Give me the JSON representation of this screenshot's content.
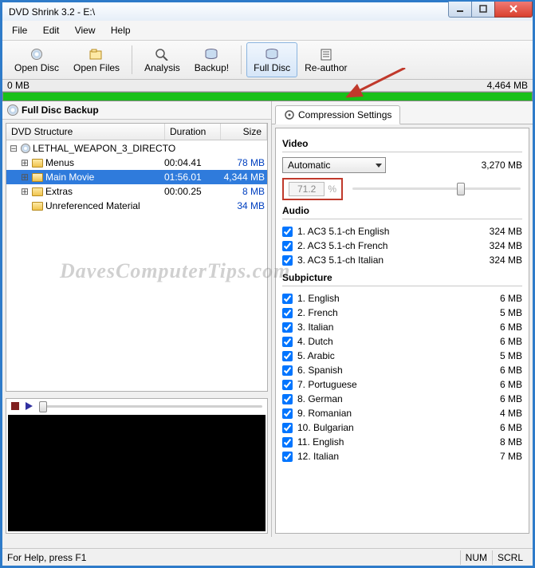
{
  "window": {
    "title": "DVD Shrink 3.2 - E:\\"
  },
  "menu": {
    "file": "File",
    "edit": "Edit",
    "view": "View",
    "help": "Help"
  },
  "toolbar": {
    "open_disc": "Open Disc",
    "open_files": "Open Files",
    "analysis": "Analysis",
    "backup": "Backup!",
    "full_disc": "Full Disc",
    "reauthor": "Re-author"
  },
  "size": {
    "left": "0 MB",
    "right": "4,464 MB"
  },
  "left_panel": {
    "title": "Full Disc Backup"
  },
  "columns": {
    "name": "DVD Structure",
    "duration": "Duration",
    "size": "Size"
  },
  "tree": {
    "root": {
      "name": "LETHAL_WEAPON_3_DIRECTO"
    },
    "menus": {
      "name": "Menus",
      "dur": "00:04.41",
      "size": "78 MB"
    },
    "main": {
      "name": "Main Movie",
      "dur": "01:56.01",
      "size": "4,344 MB"
    },
    "extras": {
      "name": "Extras",
      "dur": "00:00.25",
      "size": "8 MB"
    },
    "unref": {
      "name": "Unreferenced Material",
      "dur": "",
      "size": "34 MB"
    }
  },
  "tab": {
    "label": "Compression Settings"
  },
  "video": {
    "heading": "Video",
    "mode": "Automatic",
    "size": "3,270 MB",
    "pct": "71.2",
    "pct_sym": "%"
  },
  "audio": {
    "heading": "Audio",
    "tracks": [
      {
        "label": "1. AC3 5.1-ch English",
        "size": "324 MB"
      },
      {
        "label": "2. AC3 5.1-ch French",
        "size": "324 MB"
      },
      {
        "label": "3. AC3 5.1-ch Italian",
        "size": "324 MB"
      }
    ]
  },
  "subpicture": {
    "heading": "Subpicture",
    "tracks": [
      {
        "label": "1. English",
        "size": "6 MB"
      },
      {
        "label": "2. French",
        "size": "5 MB"
      },
      {
        "label": "3. Italian",
        "size": "6 MB"
      },
      {
        "label": "4. Dutch",
        "size": "6 MB"
      },
      {
        "label": "5. Arabic",
        "size": "5 MB"
      },
      {
        "label": "6. Spanish",
        "size": "6 MB"
      },
      {
        "label": "7. Portuguese",
        "size": "6 MB"
      },
      {
        "label": "8. German",
        "size": "6 MB"
      },
      {
        "label": "9. Romanian",
        "size": "4 MB"
      },
      {
        "label": "10. Bulgarian",
        "size": "6 MB"
      },
      {
        "label": "11. English",
        "size": "8 MB"
      },
      {
        "label": "12. Italian",
        "size": "7 MB"
      }
    ]
  },
  "status": {
    "help": "For Help, press F1",
    "num": "NUM",
    "scrl": "SCRL"
  },
  "watermark": "DavesComputerTips.com"
}
